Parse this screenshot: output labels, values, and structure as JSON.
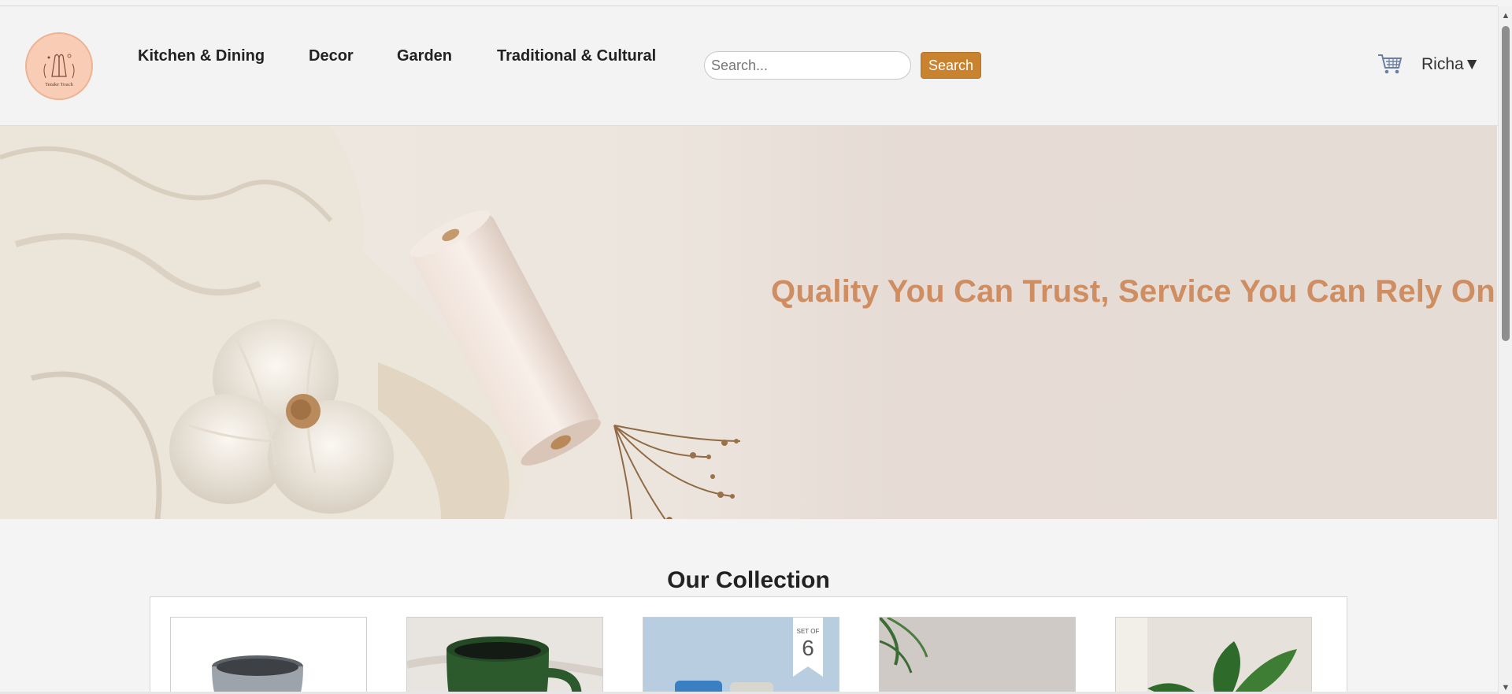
{
  "brand": {
    "logo_text": "Tender Touch",
    "colors": {
      "accent": "#c9822e",
      "hero_text": "#cf8e62",
      "logo_bg": "#f9cdb5"
    }
  },
  "nav": {
    "items": [
      {
        "label": "Kitchen & Dining"
      },
      {
        "label": "Decor"
      },
      {
        "label": "Garden"
      },
      {
        "label": "Traditional & Cultural"
      }
    ]
  },
  "search": {
    "placeholder": "Search...",
    "value": "",
    "button_label": "Search"
  },
  "header": {
    "cart_icon": "cart-icon",
    "user_label": "Richa▼"
  },
  "hero": {
    "tagline": "Quality You Can Trust, Service You Can Rely On."
  },
  "collection": {
    "title": "Our Collection",
    "cards": [
      {
        "product": "grey-mug"
      },
      {
        "product": "green-mug"
      },
      {
        "product": "blue-mug-set",
        "badge_label": "SET OF",
        "badge_value": "6"
      },
      {
        "product": "plant-pots"
      },
      {
        "product": "plant-planter"
      }
    ]
  }
}
